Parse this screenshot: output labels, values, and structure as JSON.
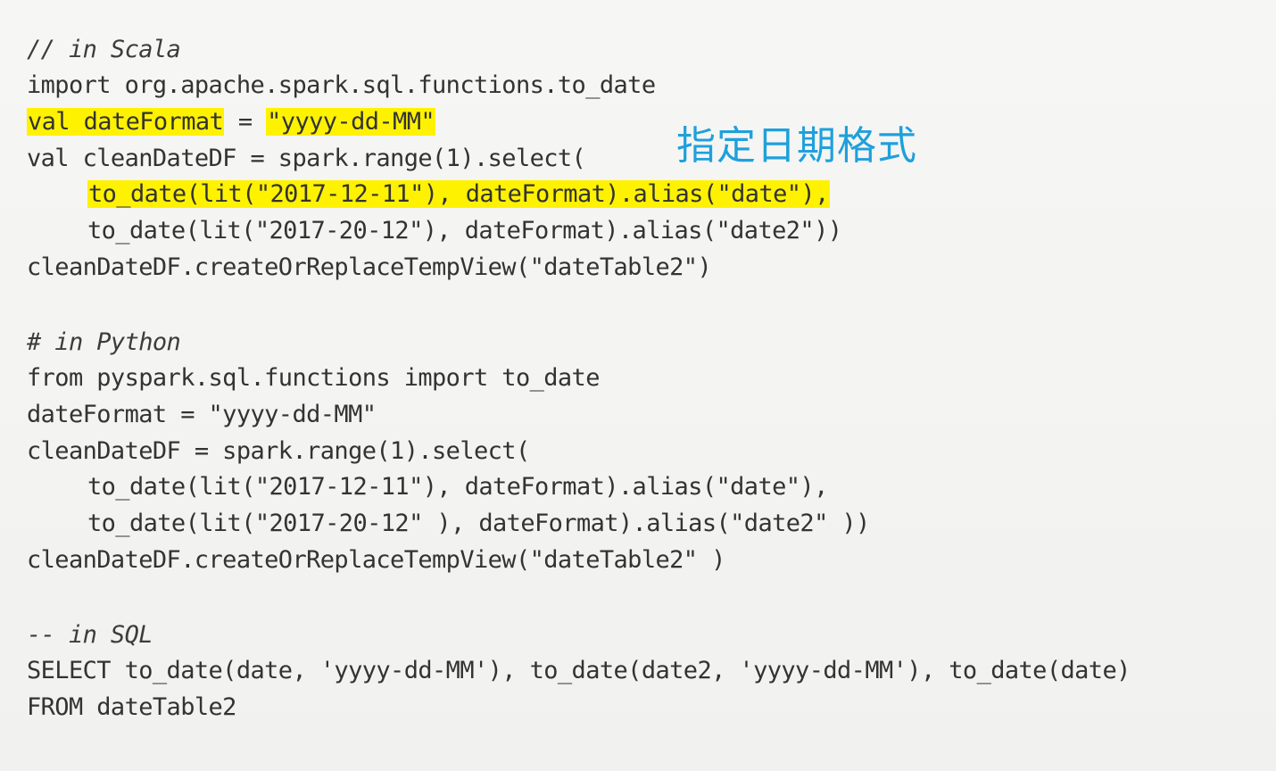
{
  "scala": {
    "comment": "// in Scala",
    "import": "import org.apache.spark.sql.functions.to_date",
    "dateformat_prefix_hl": "val dateFormat",
    "dateformat_eq": " = ",
    "dateformat_value_hl": "\"yyyy-dd-MM\"",
    "select": "val cleanDateDF = spark.range(1).select(",
    "to_date1_hl": "to_date(lit(\"2017-12-11\"), dateFormat).alias(\"date\"),",
    "to_date2": "to_date(lit(\"2017-20-12\"), dateFormat).alias(\"date2\"))",
    "view": "cleanDateDF.createOrReplaceTempView(\"dateTable2\")"
  },
  "python": {
    "comment": "# in Python",
    "import": "from pyspark.sql.functions import to_date",
    "dateformat": "dateFormat = \"yyyy-dd-MM\"",
    "select": "cleanDateDF = spark.range(1).select(",
    "to_date1": "to_date(lit(\"2017-12-11\"), dateFormat).alias(\"date\"),",
    "to_date2": "to_date(lit(\"2017-20-12\" ), dateFormat).alias(\"date2\" ))",
    "view": "cleanDateDF.createOrReplaceTempView(\"dateTable2\" )"
  },
  "sql": {
    "comment": "-- in SQL",
    "select": "SELECT to_date(date, 'yyyy-dd-MM'), to_date(date2, 'yyyy-dd-MM'), to_date(date)",
    "from": "FROM dateTable2"
  },
  "annotation": {
    "text": "指定日期格式",
    "color": "#1fa0dc"
  },
  "highlight_color": "#fff200"
}
